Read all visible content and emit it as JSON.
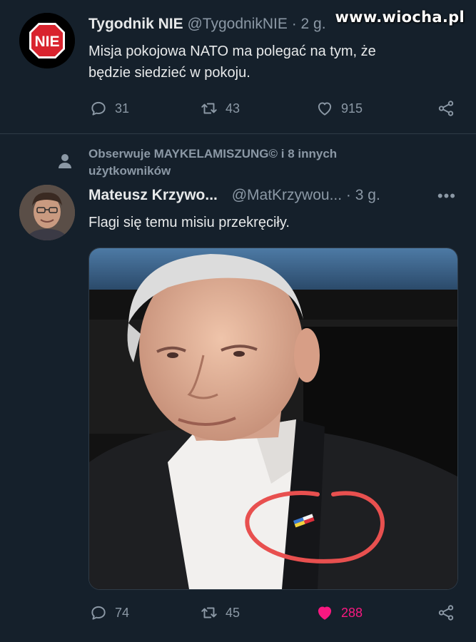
{
  "watermark": "www.wiocha.pl",
  "tweet1": {
    "avatar_text": "NIE",
    "name": "Tygodnik NIE",
    "handle": "@TygodnikNIE",
    "time": "· 2 g.",
    "text_line1": "Misja pokojowa NATO ma polegać na tym, że",
    "text_line2": "będzie siedzieć w pokoju.",
    "replies": "31",
    "retweets": "43",
    "likes": "915"
  },
  "social_context": {
    "line1": "Obserwuje MAYKELAMISZUNG© i 8 innych",
    "line2": "użytkowników"
  },
  "tweet2": {
    "name": "Mateusz Krzywo...",
    "handle": "@MatKrzywou...",
    "time": "· 3 g.",
    "more": "•••",
    "text": "Flagi się temu misiu przekręciły.",
    "replies": "74",
    "retweets": "45",
    "likes": "288",
    "like_color": "#f91880"
  },
  "colors": {
    "background": "#15202b",
    "secondary_text": "#8b98a5",
    "annotation_circle": "#e8504f"
  }
}
